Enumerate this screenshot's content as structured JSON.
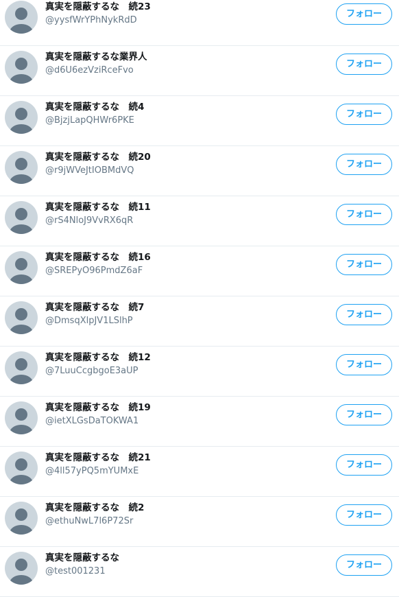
{
  "colors": {
    "accent": "#1da1f2",
    "name_text": "#14171a",
    "handle_text": "#657786",
    "divider": "#e6ecf0",
    "avatar_bg": "#ccd6dd",
    "avatar_fg": "#657786"
  },
  "follow_label": "フォロー",
  "users": [
    {
      "name": "真実を隠蔽するな　続23",
      "handle": "@yysfWrYPhNykRdD",
      "avatar_icon": "default-avatar-icon"
    },
    {
      "name": "真実を隠蔽するな業界人",
      "handle": "@d6U6ezVziRceFvo",
      "avatar_icon": "default-avatar-icon"
    },
    {
      "name": "真実を隠蔽するな　続4",
      "handle": "@BjzjLapQHWr6PKE",
      "avatar_icon": "default-avatar-icon"
    },
    {
      "name": "真実を隠蔽するな　続20",
      "handle": "@r9jWVeJtIOBMdVQ",
      "avatar_icon": "default-avatar-icon"
    },
    {
      "name": "真実を隠蔽するな　続11",
      "handle": "@rS4NloJ9VvRX6qR",
      "avatar_icon": "default-avatar-icon"
    },
    {
      "name": "真実を隠蔽するな　続16",
      "handle": "@SREPyO96PmdZ6aF",
      "avatar_icon": "default-avatar-icon"
    },
    {
      "name": "真実を隠蔽するな　続7",
      "handle": "@DmsqXlpJV1LSlhP",
      "avatar_icon": "default-avatar-icon"
    },
    {
      "name": "真実を隠蔽するな　続12",
      "handle": "@7LuuCcgbgoE3aUP",
      "avatar_icon": "default-avatar-icon"
    },
    {
      "name": "真実を隠蔽するな　続19",
      "handle": "@ietXLGsDaTOKWA1",
      "avatar_icon": "default-avatar-icon"
    },
    {
      "name": "真実を隠蔽するな　続21",
      "handle": "@4ll57yPQ5mYUMxE",
      "avatar_icon": "default-avatar-icon"
    },
    {
      "name": "真実を隠蔽するな　続2",
      "handle": "@ethuNwL7l6P72Sr",
      "avatar_icon": "default-avatar-icon"
    },
    {
      "name": "真実を隠蔽するな",
      "handle": "@test001231",
      "avatar_icon": "default-avatar-icon"
    }
  ]
}
